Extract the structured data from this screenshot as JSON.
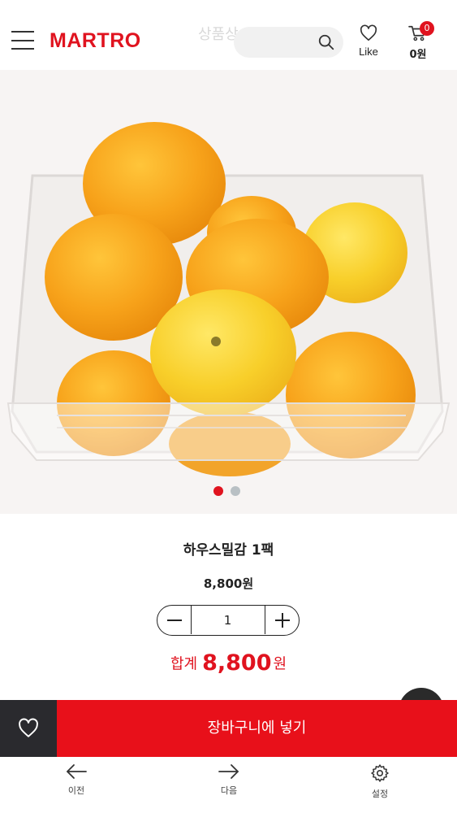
{
  "header": {
    "logo": "MARTRO",
    "ghost_title": "상품상",
    "search_placeholder": "",
    "like_label": "Like",
    "cart_badge": "0",
    "cart_total": "0원"
  },
  "carousel": {
    "total_slides": 2,
    "active_slide": 1
  },
  "product": {
    "name": "하우스밀감 1팩",
    "price": "8,800원",
    "quantity": "1"
  },
  "summary": {
    "total_label": "합계",
    "total_amount": "8,800",
    "total_unit": "원"
  },
  "actions": {
    "add_to_cart": "장바구니에 넣기"
  },
  "nav": {
    "prev": "이전",
    "next": "다음",
    "settings": "설정"
  },
  "colors": {
    "brand": "#e0131f",
    "dark": "#2a2a2e"
  }
}
